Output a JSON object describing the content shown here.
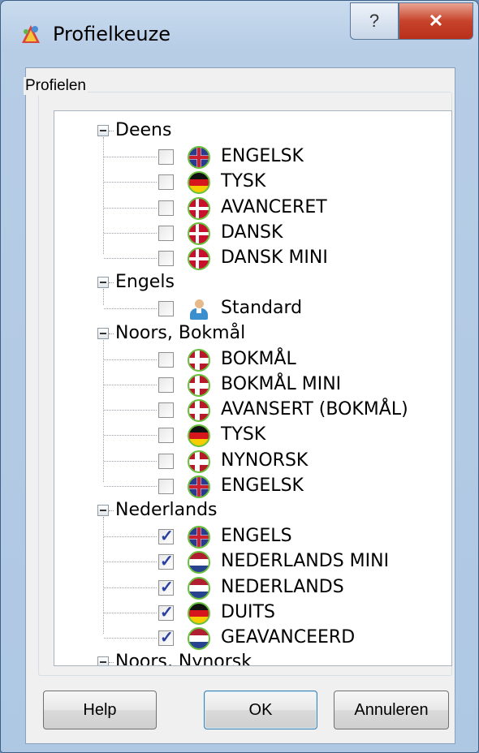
{
  "window": {
    "title": "Profielkeuze",
    "help_glyph": "?",
    "close_glyph": "✕"
  },
  "group_label": "Profielen",
  "groups": [
    {
      "label": "Deens",
      "items": [
        {
          "label": "ENGELSK",
          "checked": false,
          "icon": "flag-uk-icon"
        },
        {
          "label": "TYSK",
          "checked": false,
          "icon": "flag-de-icon"
        },
        {
          "label": "AVANCERET",
          "checked": false,
          "icon": "flag-dk-icon"
        },
        {
          "label": "DANSK",
          "checked": false,
          "icon": "flag-dk-icon"
        },
        {
          "label": "DANSK MINI",
          "checked": false,
          "icon": "flag-dk-icon"
        }
      ]
    },
    {
      "label": "Engels",
      "items": [
        {
          "label": "Standard",
          "checked": false,
          "icon": "user-icon"
        }
      ]
    },
    {
      "label": "Noors, Bokmål",
      "items": [
        {
          "label": "BOKMÅL",
          "checked": false,
          "icon": "flag-no-icon"
        },
        {
          "label": "BOKMÅL MINI",
          "checked": false,
          "icon": "flag-no-icon"
        },
        {
          "label": "AVANSERT (BOKMÅL)",
          "checked": false,
          "icon": "flag-no-icon"
        },
        {
          "label": "TYSK",
          "checked": false,
          "icon": "flag-de-icon"
        },
        {
          "label": "NYNORSK",
          "checked": false,
          "icon": "flag-no-icon"
        },
        {
          "label": "ENGELSK",
          "checked": false,
          "icon": "flag-uk-icon"
        }
      ]
    },
    {
      "label": "Nederlands",
      "items": [
        {
          "label": "ENGELS",
          "checked": true,
          "icon": "flag-uk-icon"
        },
        {
          "label": "NEDERLANDS MINI",
          "checked": true,
          "icon": "flag-nl-icon"
        },
        {
          "label": "NEDERLANDS",
          "checked": true,
          "icon": "flag-nl-icon"
        },
        {
          "label": "DUITS",
          "checked": true,
          "icon": "flag-de-icon"
        },
        {
          "label": "GEAVANCEERD",
          "checked": true,
          "icon": "flag-nl-icon"
        }
      ]
    },
    {
      "label": "Noors, Nynorsk",
      "items": []
    }
  ],
  "buttons": {
    "help": "Help",
    "ok": "OK",
    "cancel": "Annuleren"
  }
}
